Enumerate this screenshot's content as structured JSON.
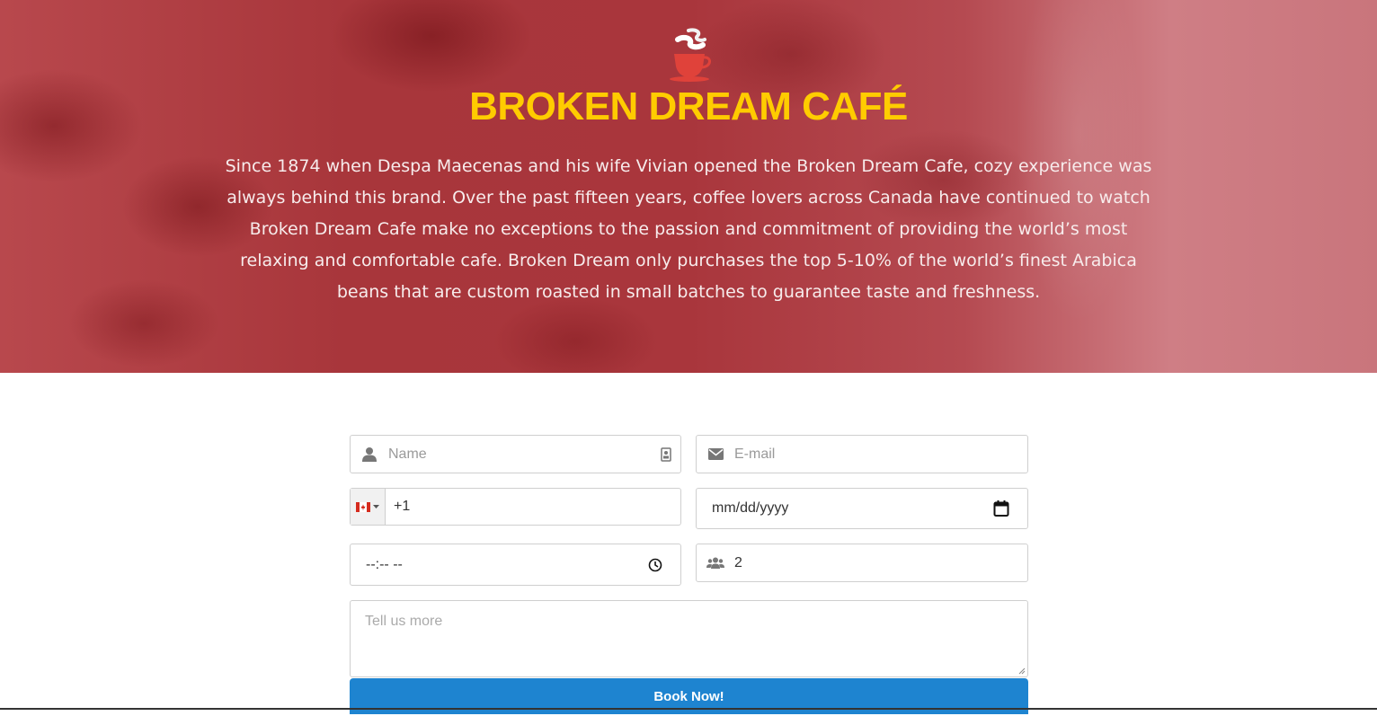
{
  "hero": {
    "logo_icon": "coffee-cup-icon",
    "title": "BROKEN DREAM CAFÉ",
    "description": "Since 1874 when Despa Maecenas and his wife Vivian opened the Broken Dream Cafe, cozy experience was always behind this brand. Over the past fifteen years, coffee lovers across Canada have continued to watch Broken Dream Cafe make no exceptions to the passion and commitment of providing the world’s most relaxing and comfortable cafe. Broken Dream only purchases the top 5-10% of the world’s finest Arabica beans that are custom roasted in small batches to guarantee taste and freshness."
  },
  "form": {
    "name": {
      "placeholder": "Name",
      "icon": "user-icon",
      "end_icon": "contact-card-icon"
    },
    "email": {
      "placeholder": "E-mail",
      "icon": "envelope-icon"
    },
    "phone": {
      "country_flag": "canada-flag-icon",
      "value": "+1"
    },
    "date": {
      "value": "mm/dd/yyyy",
      "icon": "calendar-icon"
    },
    "time": {
      "value": "--:-- --",
      "icon": "clock-icon"
    },
    "guests": {
      "value": "2",
      "icon": "users-icon"
    },
    "message": {
      "placeholder": "Tell us more"
    },
    "submit_label": "Book Now!"
  },
  "colors": {
    "title": "#ffcc00",
    "button": "#1e84d0",
    "hero_overlay": "#a9363c"
  }
}
